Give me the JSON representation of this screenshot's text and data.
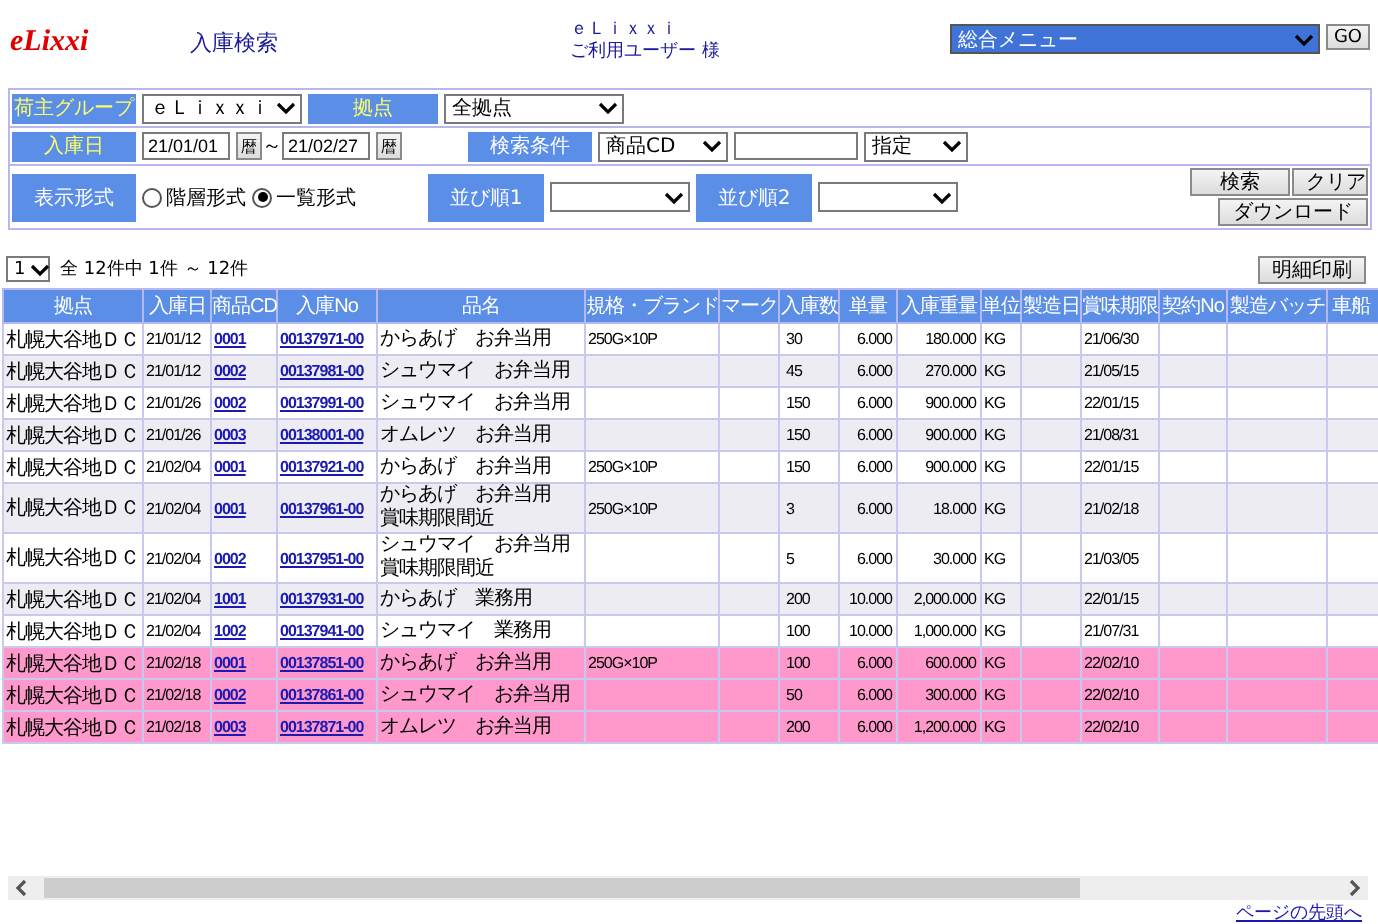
{
  "header": {
    "logo": "eLixxi",
    "page_title": "入庫検索",
    "company": "ｅＬｉｘｘｉ",
    "user": "ご利用ユーザー 様",
    "menu": {
      "value": "総合メニュー"
    },
    "go_button": "GO"
  },
  "search_form": {
    "owner_group": {
      "label": "荷主グループ",
      "kind": "required",
      "value": "ｅＬｉｘｘｉ"
    },
    "base": {
      "label": "拠点",
      "kind": "required",
      "value": "全拠点"
    },
    "date": {
      "label": "入庫日",
      "kind": "required",
      "from": "21/01/01",
      "from_calendar_button": "暦",
      "separator": "～",
      "to": "21/02/27",
      "to_calendar_button": "暦"
    },
    "condition": {
      "label": "検索条件",
      "kind": "optional",
      "field": "商品CD",
      "match": "指定"
    },
    "display": {
      "label": "表示形式",
      "kind": "optional",
      "options": [
        {
          "label": "階層形式",
          "selected": false
        },
        {
          "label": "一覧形式",
          "selected": true
        }
      ]
    },
    "sort1": {
      "label": "並び順1",
      "kind": "optional"
    },
    "sort2": {
      "label": "並び順2",
      "kind": "optional"
    },
    "buttons": [
      "検索",
      "クリア",
      "ダウンロード"
    ]
  },
  "results": {
    "page_select": "1",
    "summary": "全 12件中 1件 ～ 12件",
    "print_button": "明細印刷",
    "columns": [
      "拠点",
      "入庫日",
      "商品CD",
      "入庫No",
      "品名",
      "規格・ブランド",
      "マーク",
      "入庫数",
      "単量",
      "入庫重量",
      "単位",
      "製造日",
      "賞味期限",
      "契約No",
      "製造バッチ",
      "車船"
    ],
    "rows": [
      {
        "highlighted": false,
        "base": "札幌大谷地ＤＣ",
        "date": "21/01/12",
        "product_cd": "0001",
        "receipt_no": "00137971-00",
        "name": "からあげ　お弁当用",
        "spec": "250G×10P",
        "qty": "30",
        "unit_weight": "6.000",
        "weight": "180.000",
        "unit": "KG",
        "best_before": "21/06/30"
      },
      {
        "highlighted": false,
        "base": "札幌大谷地ＤＣ",
        "date": "21/01/12",
        "product_cd": "0002",
        "receipt_no": "00137981-00",
        "name": "シュウマイ　お弁当用",
        "qty": "45",
        "unit_weight": "6.000",
        "weight": "270.000",
        "unit": "KG",
        "best_before": "21/05/15"
      },
      {
        "highlighted": false,
        "base": "札幌大谷地ＤＣ",
        "date": "21/01/26",
        "product_cd": "0002",
        "receipt_no": "00137991-00",
        "name": "シュウマイ　お弁当用",
        "qty": "150",
        "unit_weight": "6.000",
        "weight": "900.000",
        "unit": "KG",
        "best_before": "22/01/15"
      },
      {
        "highlighted": false,
        "base": "札幌大谷地ＤＣ",
        "date": "21/01/26",
        "product_cd": "0003",
        "receipt_no": "00138001-00",
        "name": "オムレツ　お弁当用",
        "qty": "150",
        "unit_weight": "6.000",
        "weight": "900.000",
        "unit": "KG",
        "best_before": "21/08/31"
      },
      {
        "highlighted": false,
        "base": "札幌大谷地ＤＣ",
        "date": "21/02/04",
        "product_cd": "0001",
        "receipt_no": "00137921-00",
        "name": "からあげ　お弁当用",
        "spec": "250G×10P",
        "qty": "150",
        "unit_weight": "6.000",
        "weight": "900.000",
        "unit": "KG",
        "best_before": "22/01/15"
      },
      {
        "highlighted": false,
        "base": "札幌大谷地ＤＣ",
        "date": "21/02/04",
        "product_cd": "0001",
        "receipt_no": "00137961-00",
        "name": "からあげ　お弁当用",
        "note": "賞味期限間近",
        "spec": "250G×10P",
        "qty": "3",
        "unit_weight": "6.000",
        "weight": "18.000",
        "unit": "KG",
        "best_before": "21/02/18"
      },
      {
        "highlighted": false,
        "base": "札幌大谷地ＤＣ",
        "date": "21/02/04",
        "product_cd": "0002",
        "receipt_no": "00137951-00",
        "name": "シュウマイ　お弁当用",
        "note": "賞味期限間近",
        "qty": "5",
        "unit_weight": "6.000",
        "weight": "30.000",
        "unit": "KG",
        "best_before": "21/03/05"
      },
      {
        "highlighted": false,
        "base": "札幌大谷地ＤＣ",
        "date": "21/02/04",
        "product_cd": "1001",
        "receipt_no": "00137931-00",
        "name": "からあげ　業務用",
        "qty": "200",
        "unit_weight": "10.000",
        "weight": "2,000.000",
        "unit": "KG",
        "best_before": "22/01/15"
      },
      {
        "highlighted": false,
        "base": "札幌大谷地ＤＣ",
        "date": "21/02/04",
        "product_cd": "1002",
        "receipt_no": "00137941-00",
        "name": "シュウマイ　業務用",
        "qty": "100",
        "unit_weight": "10.000",
        "weight": "1,000.000",
        "unit": "KG",
        "best_before": "21/07/31"
      },
      {
        "highlighted": true,
        "base": "札幌大谷地ＤＣ",
        "date": "21/02/18",
        "product_cd": "0001",
        "receipt_no": "00137851-00",
        "name": "からあげ　お弁当用",
        "spec": "250G×10P",
        "qty": "100",
        "unit_weight": "6.000",
        "weight": "600.000",
        "unit": "KG",
        "best_before": "22/02/10"
      },
      {
        "highlighted": true,
        "base": "札幌大谷地ＤＣ",
        "date": "21/02/18",
        "product_cd": "0002",
        "receipt_no": "00137861-00",
        "name": "シュウマイ　お弁当用",
        "qty": "50",
        "unit_weight": "6.000",
        "weight": "300.000",
        "unit": "KG",
        "best_before": "22/02/10"
      },
      {
        "highlighted": true,
        "base": "札幌大谷地ＤＣ",
        "date": "21/02/18",
        "product_cd": "0003",
        "receipt_no": "00137871-00",
        "name": "オムレツ　お弁当用",
        "qty": "200",
        "unit_weight": "6.000",
        "weight": "1,200.000",
        "unit": "KG",
        "best_before": "22/02/10"
      }
    ]
  },
  "footer": {
    "top_link": "ページの先頭へ"
  }
}
